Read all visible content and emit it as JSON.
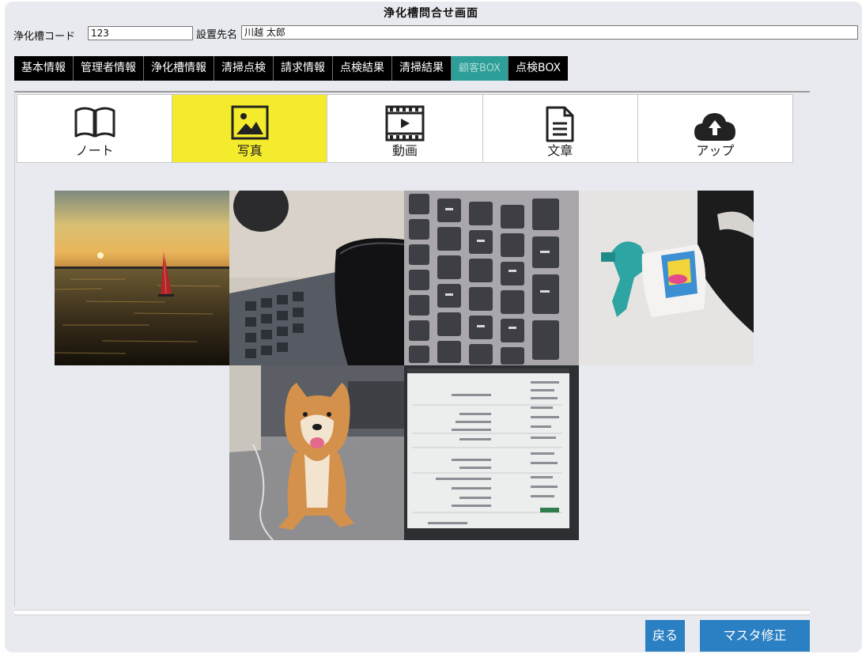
{
  "header": {
    "title": "浄化槽問合せ画面"
  },
  "form": {
    "code_label": "浄化槽コード",
    "code_value": "123",
    "location_label": "設置先名",
    "location_value": "川越 太郎"
  },
  "tabs": [
    {
      "label": "基本情報"
    },
    {
      "label": "管理者情報"
    },
    {
      "label": "浄化槽情報"
    },
    {
      "label": "清掃点検"
    },
    {
      "label": "請求情報"
    },
    {
      "label": "点検結果"
    },
    {
      "label": "清掃結果"
    },
    {
      "label": "顧客BOX",
      "active": true
    },
    {
      "label": "点検BOX"
    }
  ],
  "media_types": [
    {
      "label": "ノート",
      "icon": "book-icon"
    },
    {
      "label": "写真",
      "icon": "image-icon",
      "active": true
    },
    {
      "label": "動画",
      "icon": "video-icon"
    },
    {
      "label": "文章",
      "icon": "document-icon"
    },
    {
      "label": "アップ",
      "icon": "cloud-upload-icon"
    }
  ],
  "photos": [
    {
      "subject": "sunset-windsurf"
    },
    {
      "subject": "laptop-keyboard-phone"
    },
    {
      "subject": "keyboard-closeup"
    },
    {
      "subject": "spray-bottle"
    },
    {
      "subject": "shiba-dog"
    },
    {
      "subject": "screen-document"
    }
  ],
  "footer": {
    "back_label": "戻る",
    "master_edit_label": "マスタ修正"
  },
  "colors": {
    "active_tab": "#2e9e98",
    "active_media": "#f4eb2c",
    "button": "#2b7fc3",
    "background": "#e9eaef"
  }
}
